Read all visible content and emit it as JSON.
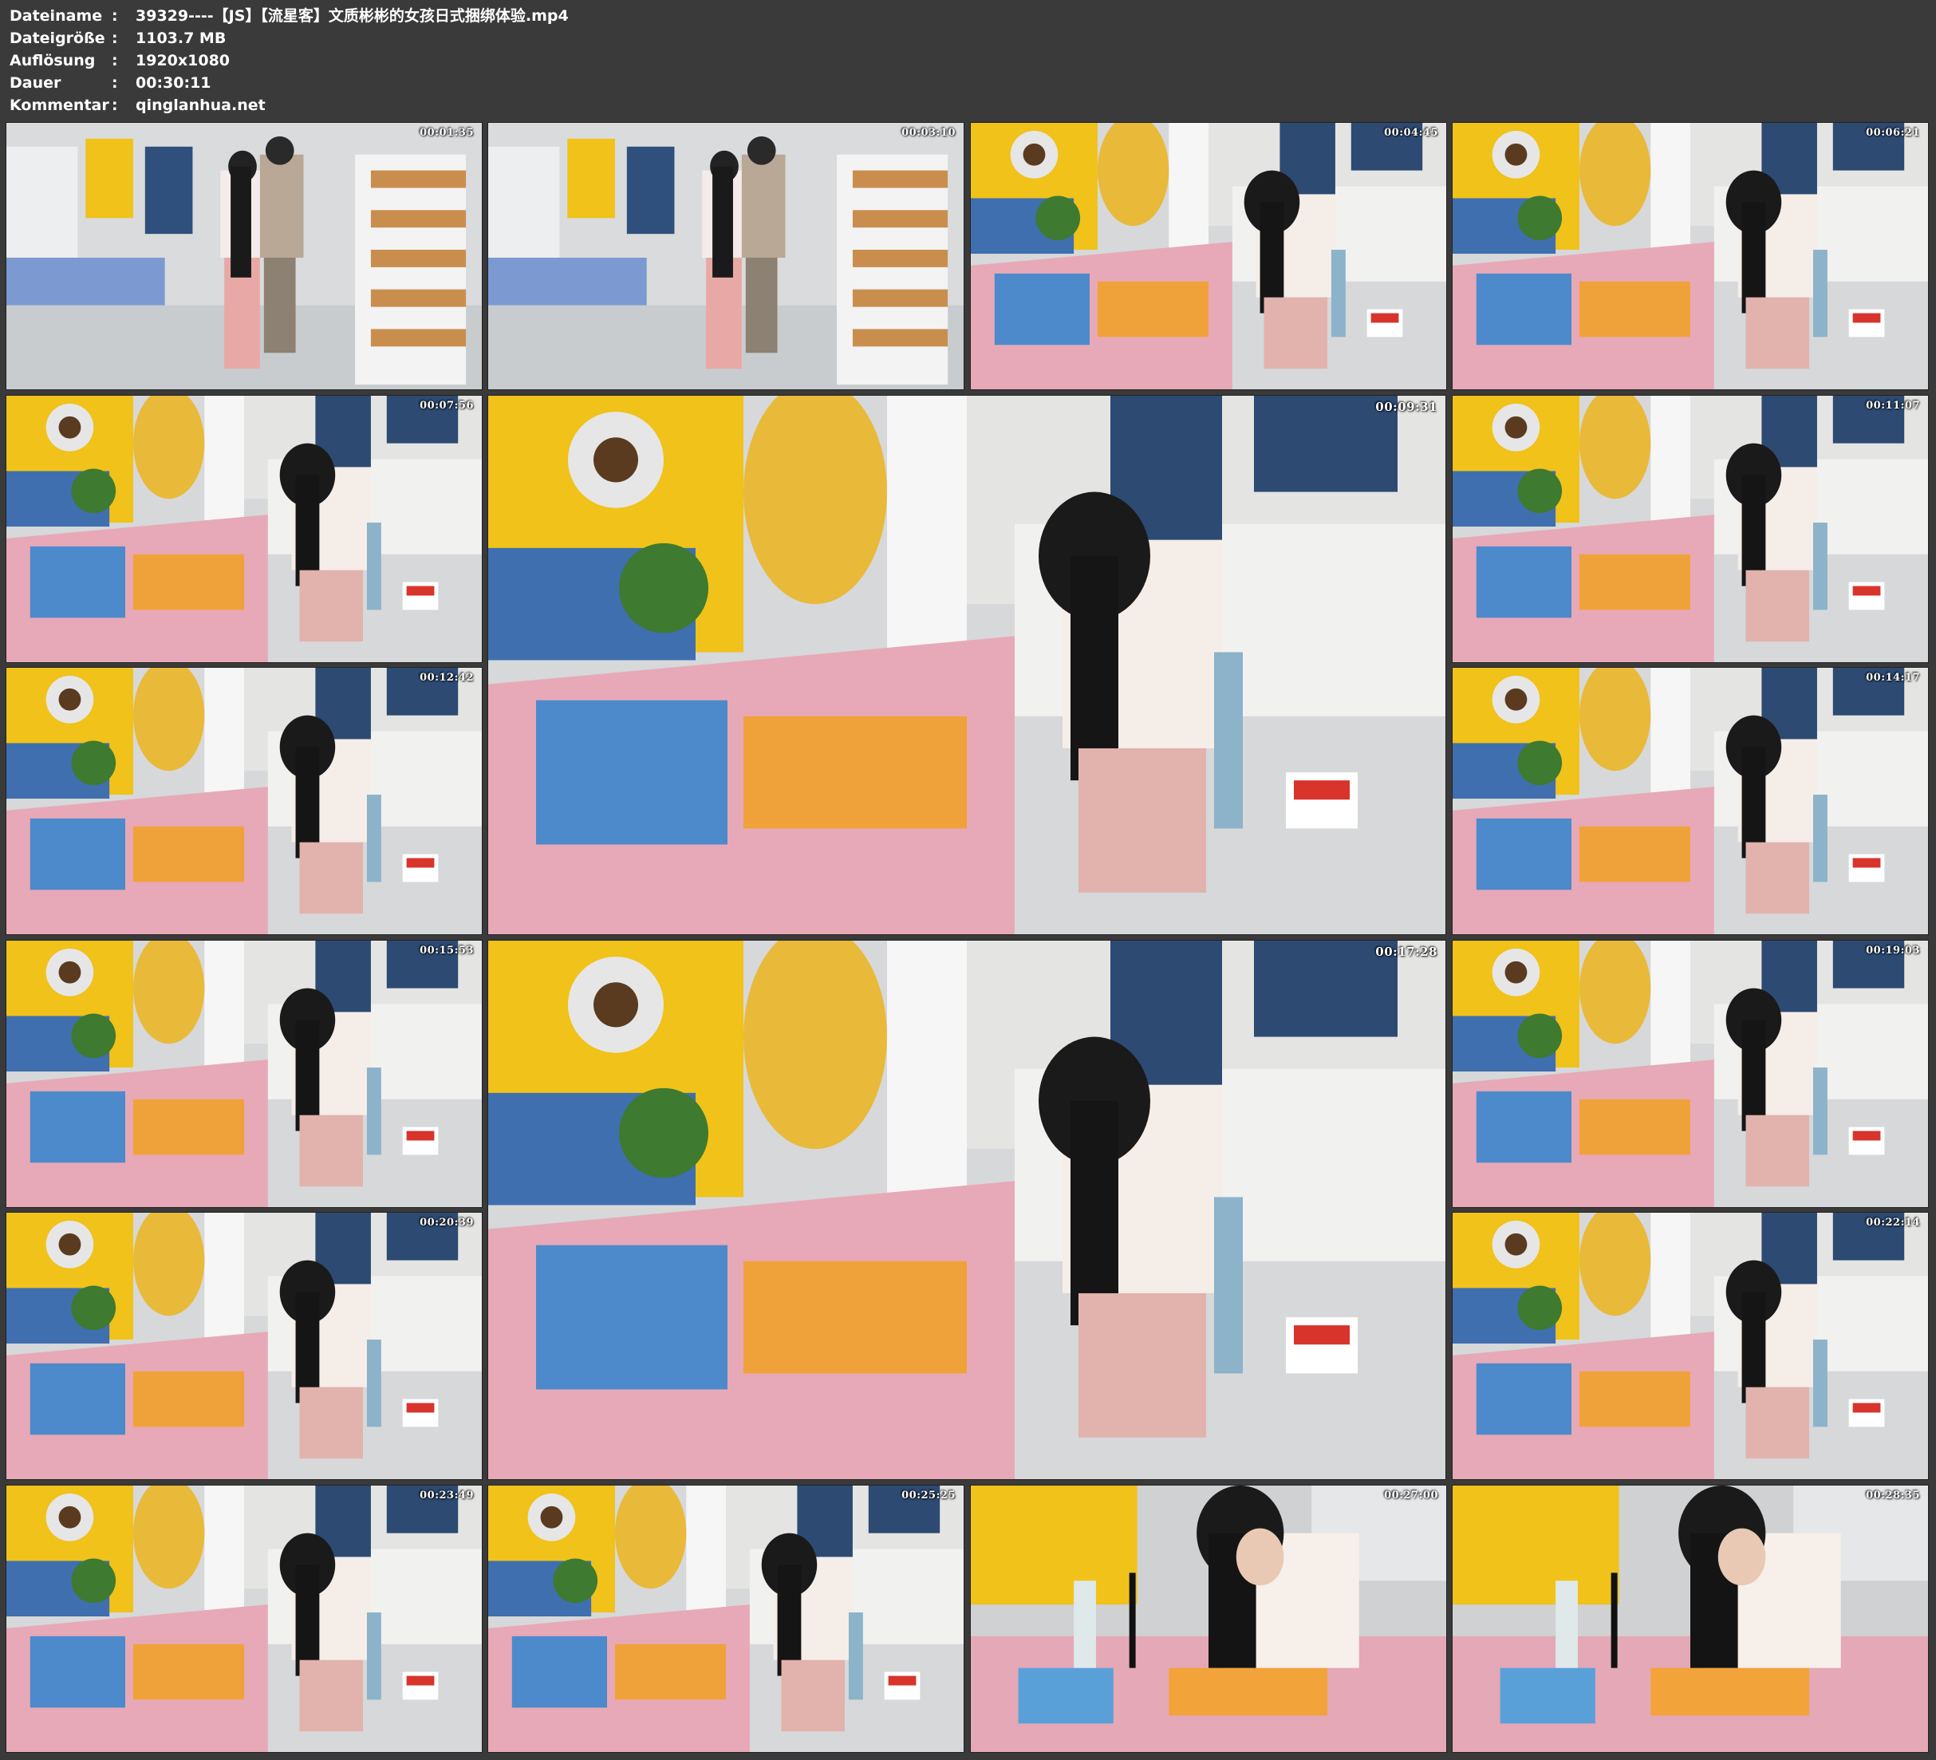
{
  "metadata": [
    {
      "key": "Dateiname",
      "value": "39329----【JS】【流星客】文质彬彬的女孩日式捆绑体验.mp4"
    },
    {
      "key": "Dateigröße",
      "value": "1103.7 MB"
    },
    {
      "key": "Auflösung",
      "value": "1920x1080"
    },
    {
      "key": "Dauer",
      "value": "00:30:11"
    },
    {
      "key": "Kommentar",
      "value": "qinglanhua.net"
    }
  ],
  "separator": ":",
  "thumbnails": [
    {
      "time": "00:01:35",
      "scene": "stairs"
    },
    {
      "time": "00:03:10",
      "scene": "stairs"
    },
    {
      "time": "00:04:45",
      "scene": "table"
    },
    {
      "time": "00:06:21",
      "scene": "table"
    },
    {
      "time": "00:07:56",
      "scene": "table"
    },
    {
      "time": "00:09:31",
      "scene": "table"
    },
    {
      "time": "00:11:07",
      "scene": "table"
    },
    {
      "time": "00:12:42",
      "scene": "table"
    },
    {
      "time": "00:14:17",
      "scene": "table"
    },
    {
      "time": "00:15:53",
      "scene": "table"
    },
    {
      "time": "00:17:28",
      "scene": "table"
    },
    {
      "time": "00:19:03",
      "scene": "table"
    },
    {
      "time": "00:20:39",
      "scene": "table"
    },
    {
      "time": "00:22:14",
      "scene": "table"
    },
    {
      "time": "00:23:49",
      "scene": "table"
    },
    {
      "time": "00:25:25",
      "scene": "table"
    },
    {
      "time": "00:27:00",
      "scene": "closeup"
    },
    {
      "time": "00:28:35",
      "scene": "closeup"
    }
  ]
}
